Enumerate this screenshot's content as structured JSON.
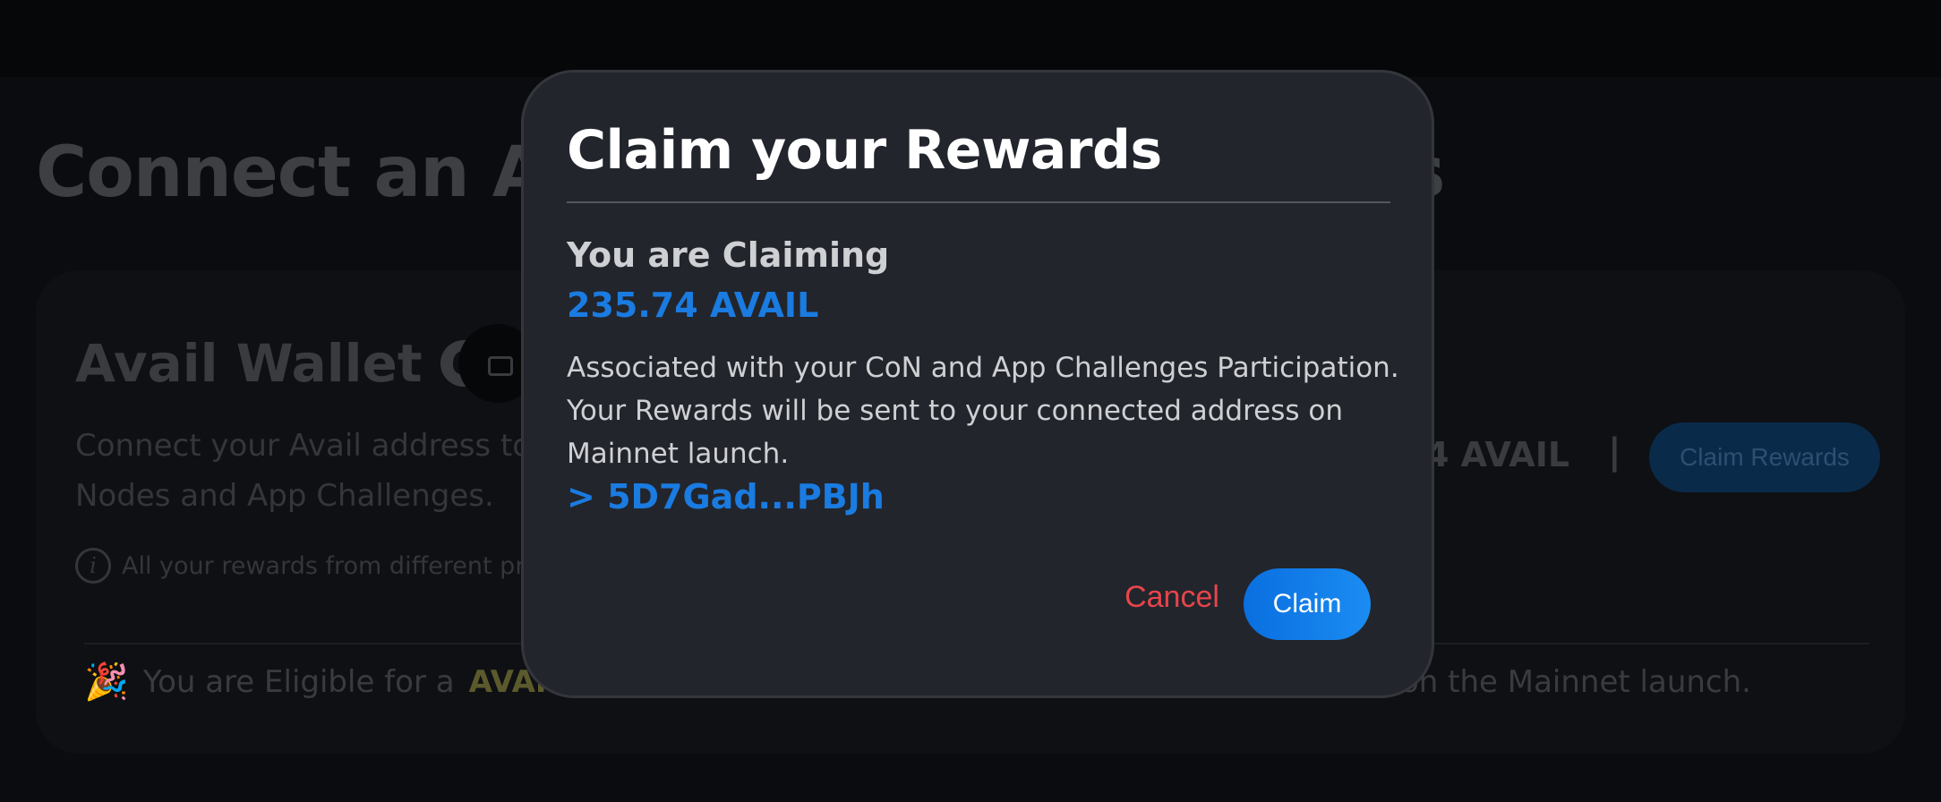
{
  "background": {
    "page_title_start": "Connect an Ava",
    "page_title_end": "s",
    "wallet": {
      "heading": "Avail Wallet",
      "description": "Connect your Avail address to Nodes and App Challenges.",
      "info_text": "All your rewards from different pro",
      "eligible_prefix": "You are Eligible for a",
      "eligible_highlight": "AVAIL",
      "eligible_suffix": "on the Mainnet launch.",
      "balance_text": "4 AVAIL",
      "separator": "|",
      "claim_rewards_label": "Claim Rewards"
    }
  },
  "modal": {
    "title": "Claim your Rewards",
    "claiming_label": "You are Claiming",
    "amount": "235.74 AVAIL",
    "description": "Associated with your CoN and App Challenges Participation. Your Rewards will be sent to your connected address on Mainnet launch.",
    "address": "> 5D7Gad...PBJh",
    "cancel_label": "Cancel",
    "claim_label": "Claim"
  },
  "colors": {
    "modal_bg": "#22252c",
    "accent_blue": "#1a7be0",
    "cancel_red": "#e8444b"
  },
  "icons": [
    "wallet-logo-icon",
    "wallet-connect-icon",
    "info-icon",
    "party-popper-icon"
  ]
}
